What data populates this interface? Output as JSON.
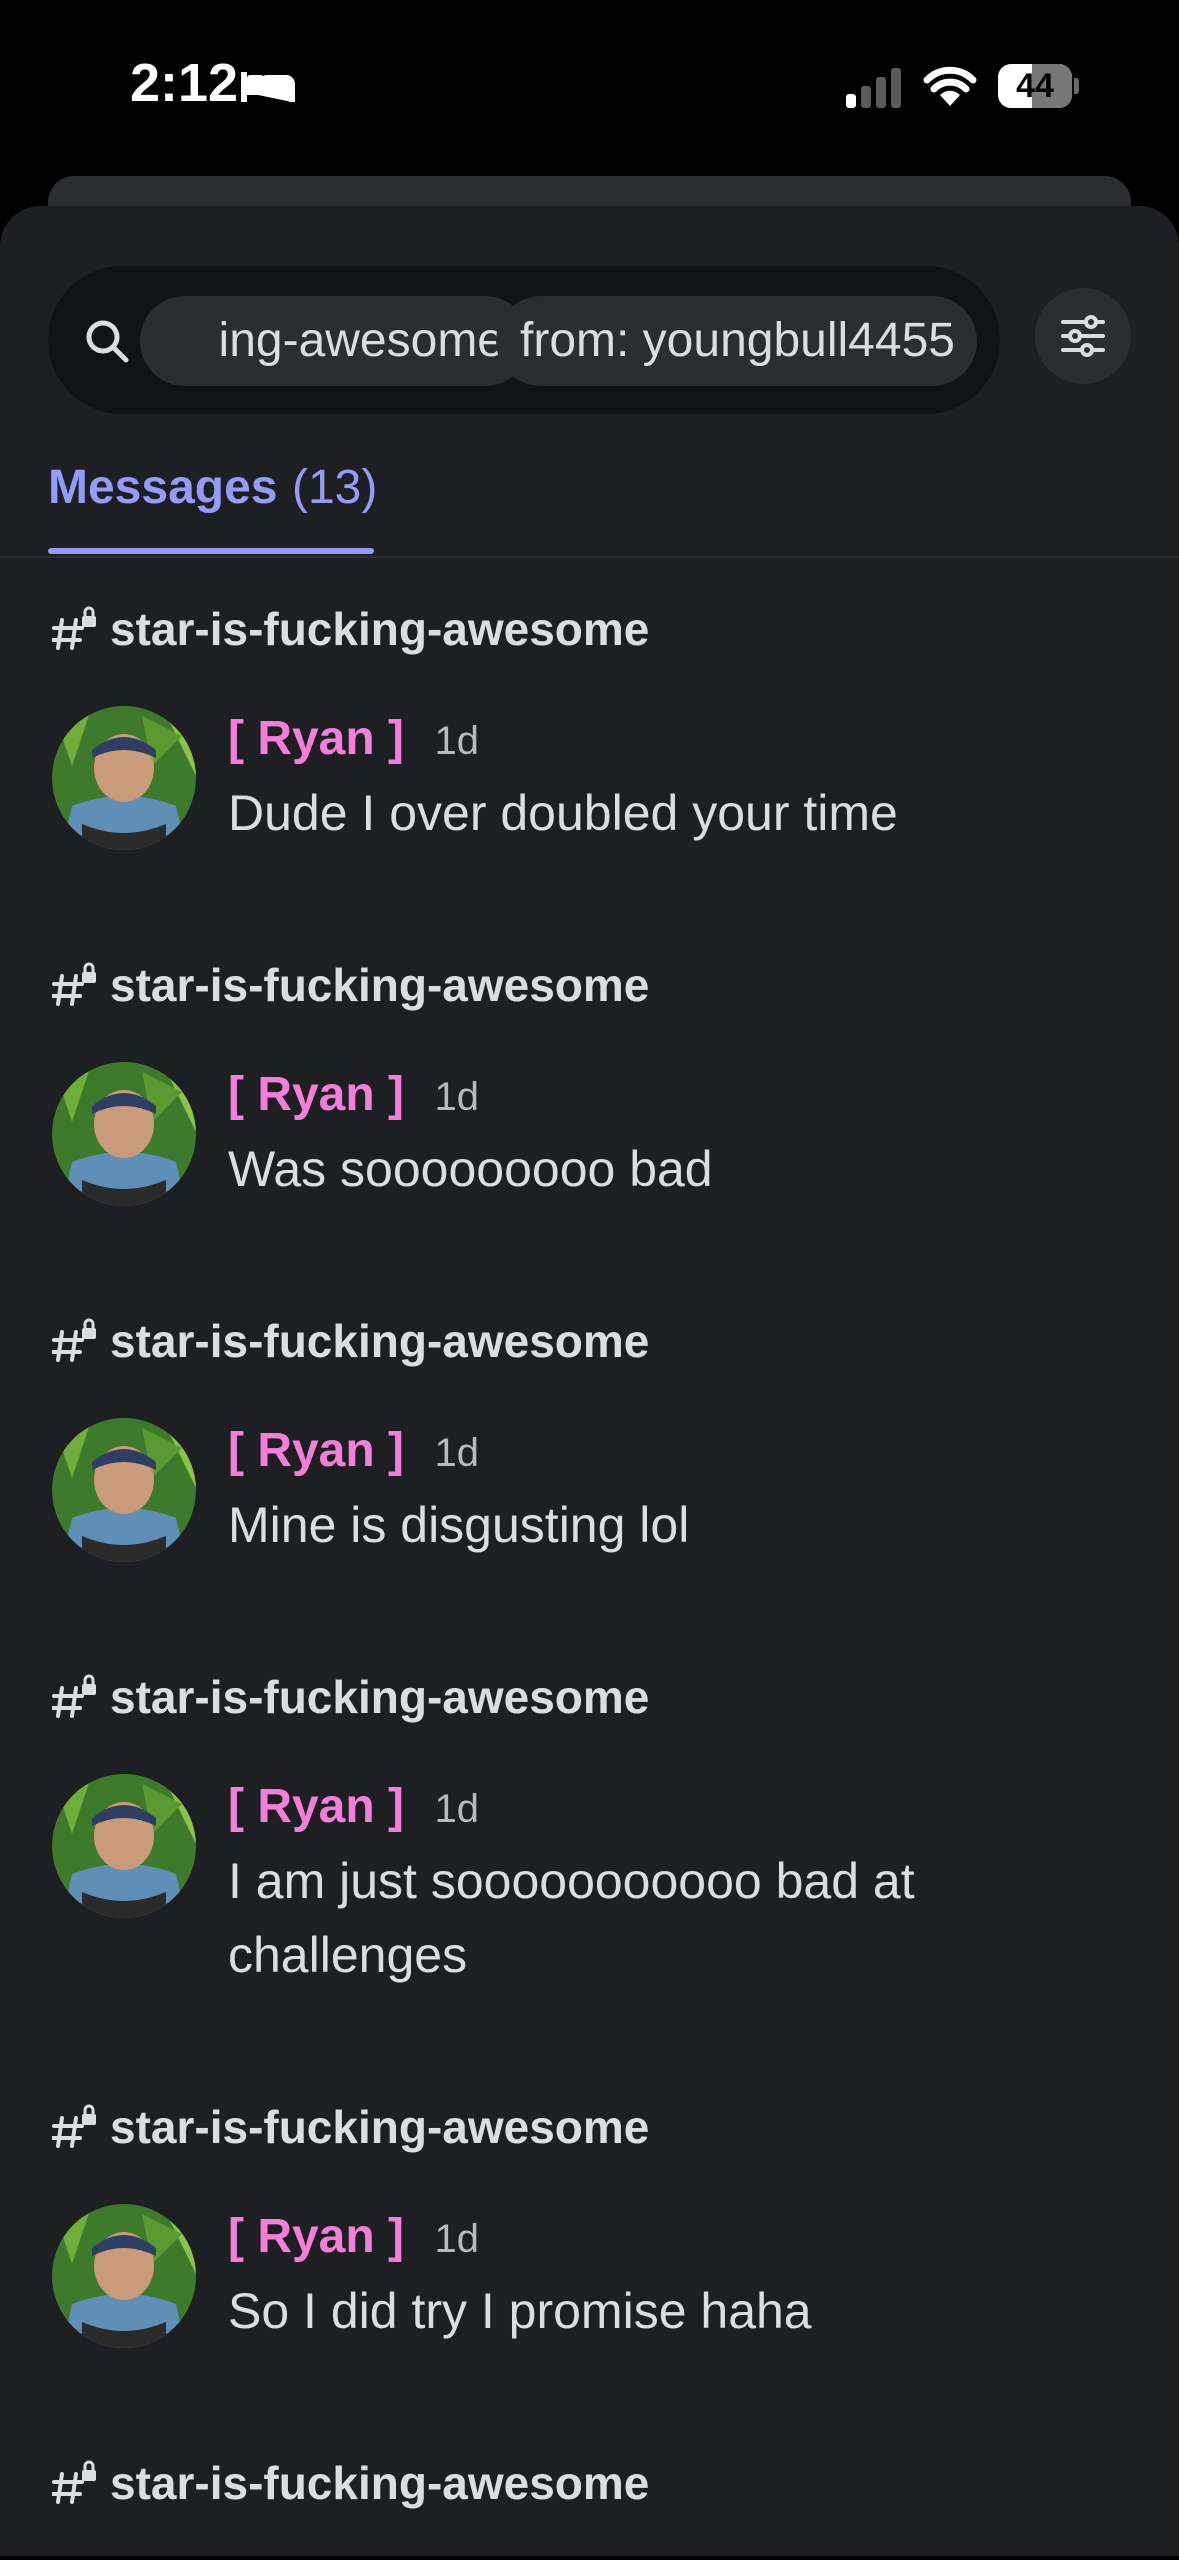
{
  "status_bar": {
    "time": "2:12",
    "battery": "44"
  },
  "search": {
    "channel_chip": "ing-awesome",
    "from_chip": "from: youngbull4455"
  },
  "tabs": [
    {
      "label": "Messages",
      "count": "(13)"
    }
  ],
  "results": [
    {
      "channel": "star-is-fucking-awesome",
      "author": "[ Ryan ]",
      "time": "1d",
      "text": "Dude I over doubled your time"
    },
    {
      "channel": "star-is-fucking-awesome",
      "author": "[ Ryan ]",
      "time": "1d",
      "text": "Was sooooooooo bad"
    },
    {
      "channel": "star-is-fucking-awesome",
      "author": "[ Ryan ]",
      "time": "1d",
      "text": "Mine is disgusting lol"
    },
    {
      "channel": "star-is-fucking-awesome",
      "author": "[ Ryan ]",
      "time": "1d",
      "text": "I am just sooooooooooo bad at challenges"
    },
    {
      "channel": "star-is-fucking-awesome",
      "author": "[ Ryan ]",
      "time": "1d",
      "text": "So I did try I promise haha"
    },
    {
      "channel": "star-is-fucking-awesome"
    }
  ],
  "colors": {
    "accent": "#949cf7",
    "author": "#f47fdb",
    "background": "#1e1f22"
  }
}
